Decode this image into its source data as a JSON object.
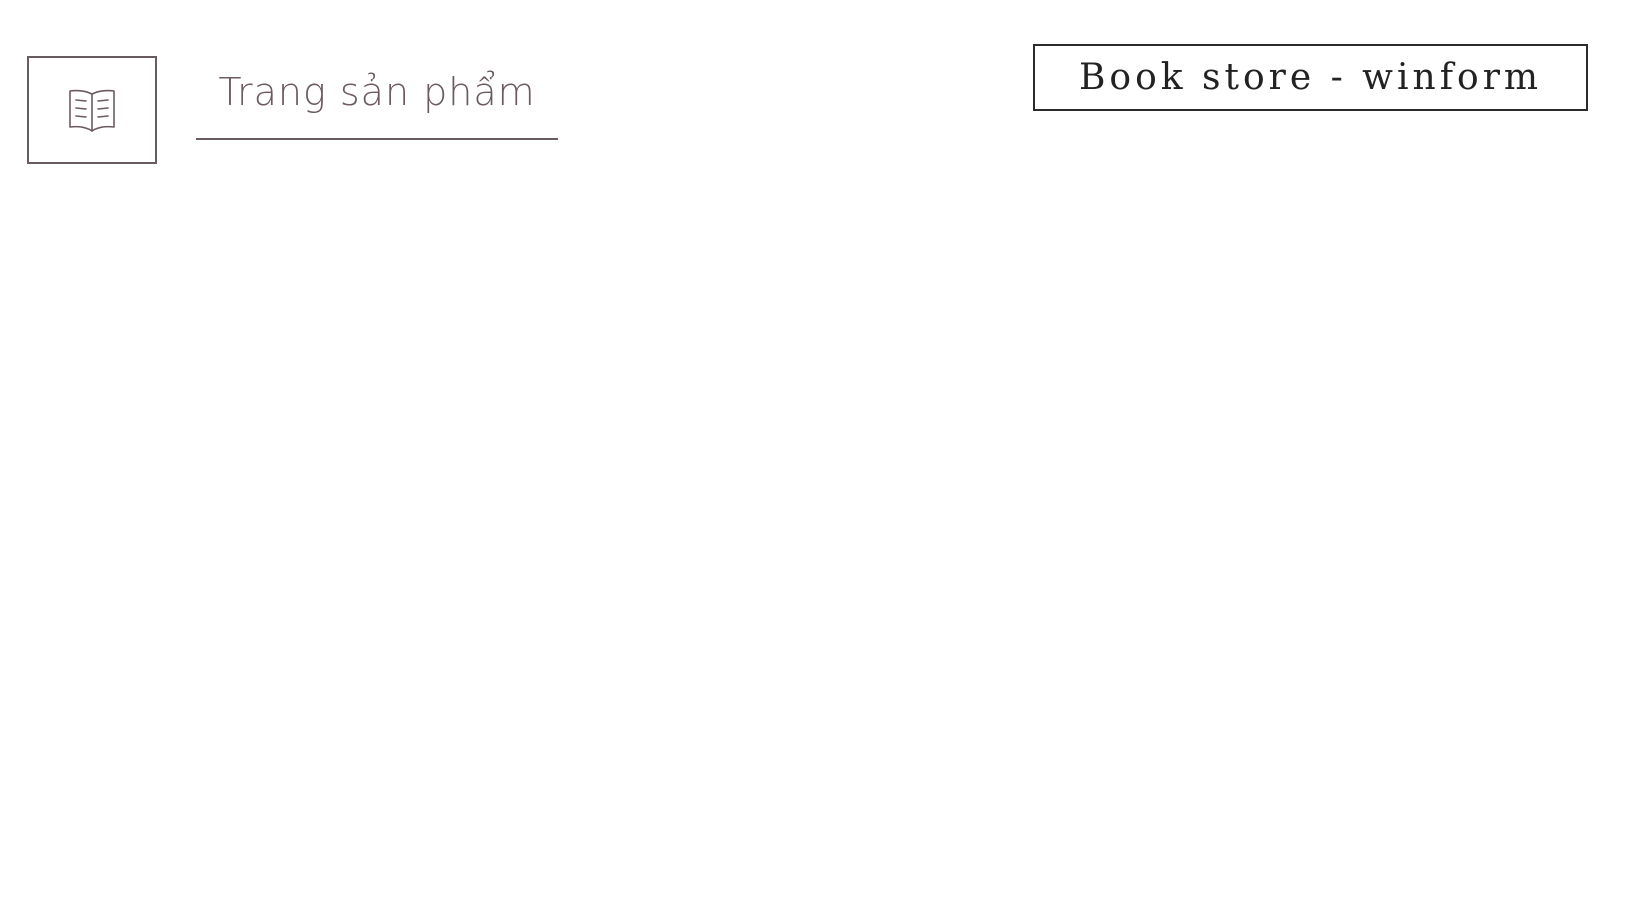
{
  "header": {
    "logo_icon": "open-book-icon",
    "page_title": "Trang sản phẩm",
    "brand_label": "Book store - winform"
  },
  "colors": {
    "accent": "#6b5b5e",
    "brand_border": "#2b2b2b",
    "background": "#ffffff"
  }
}
